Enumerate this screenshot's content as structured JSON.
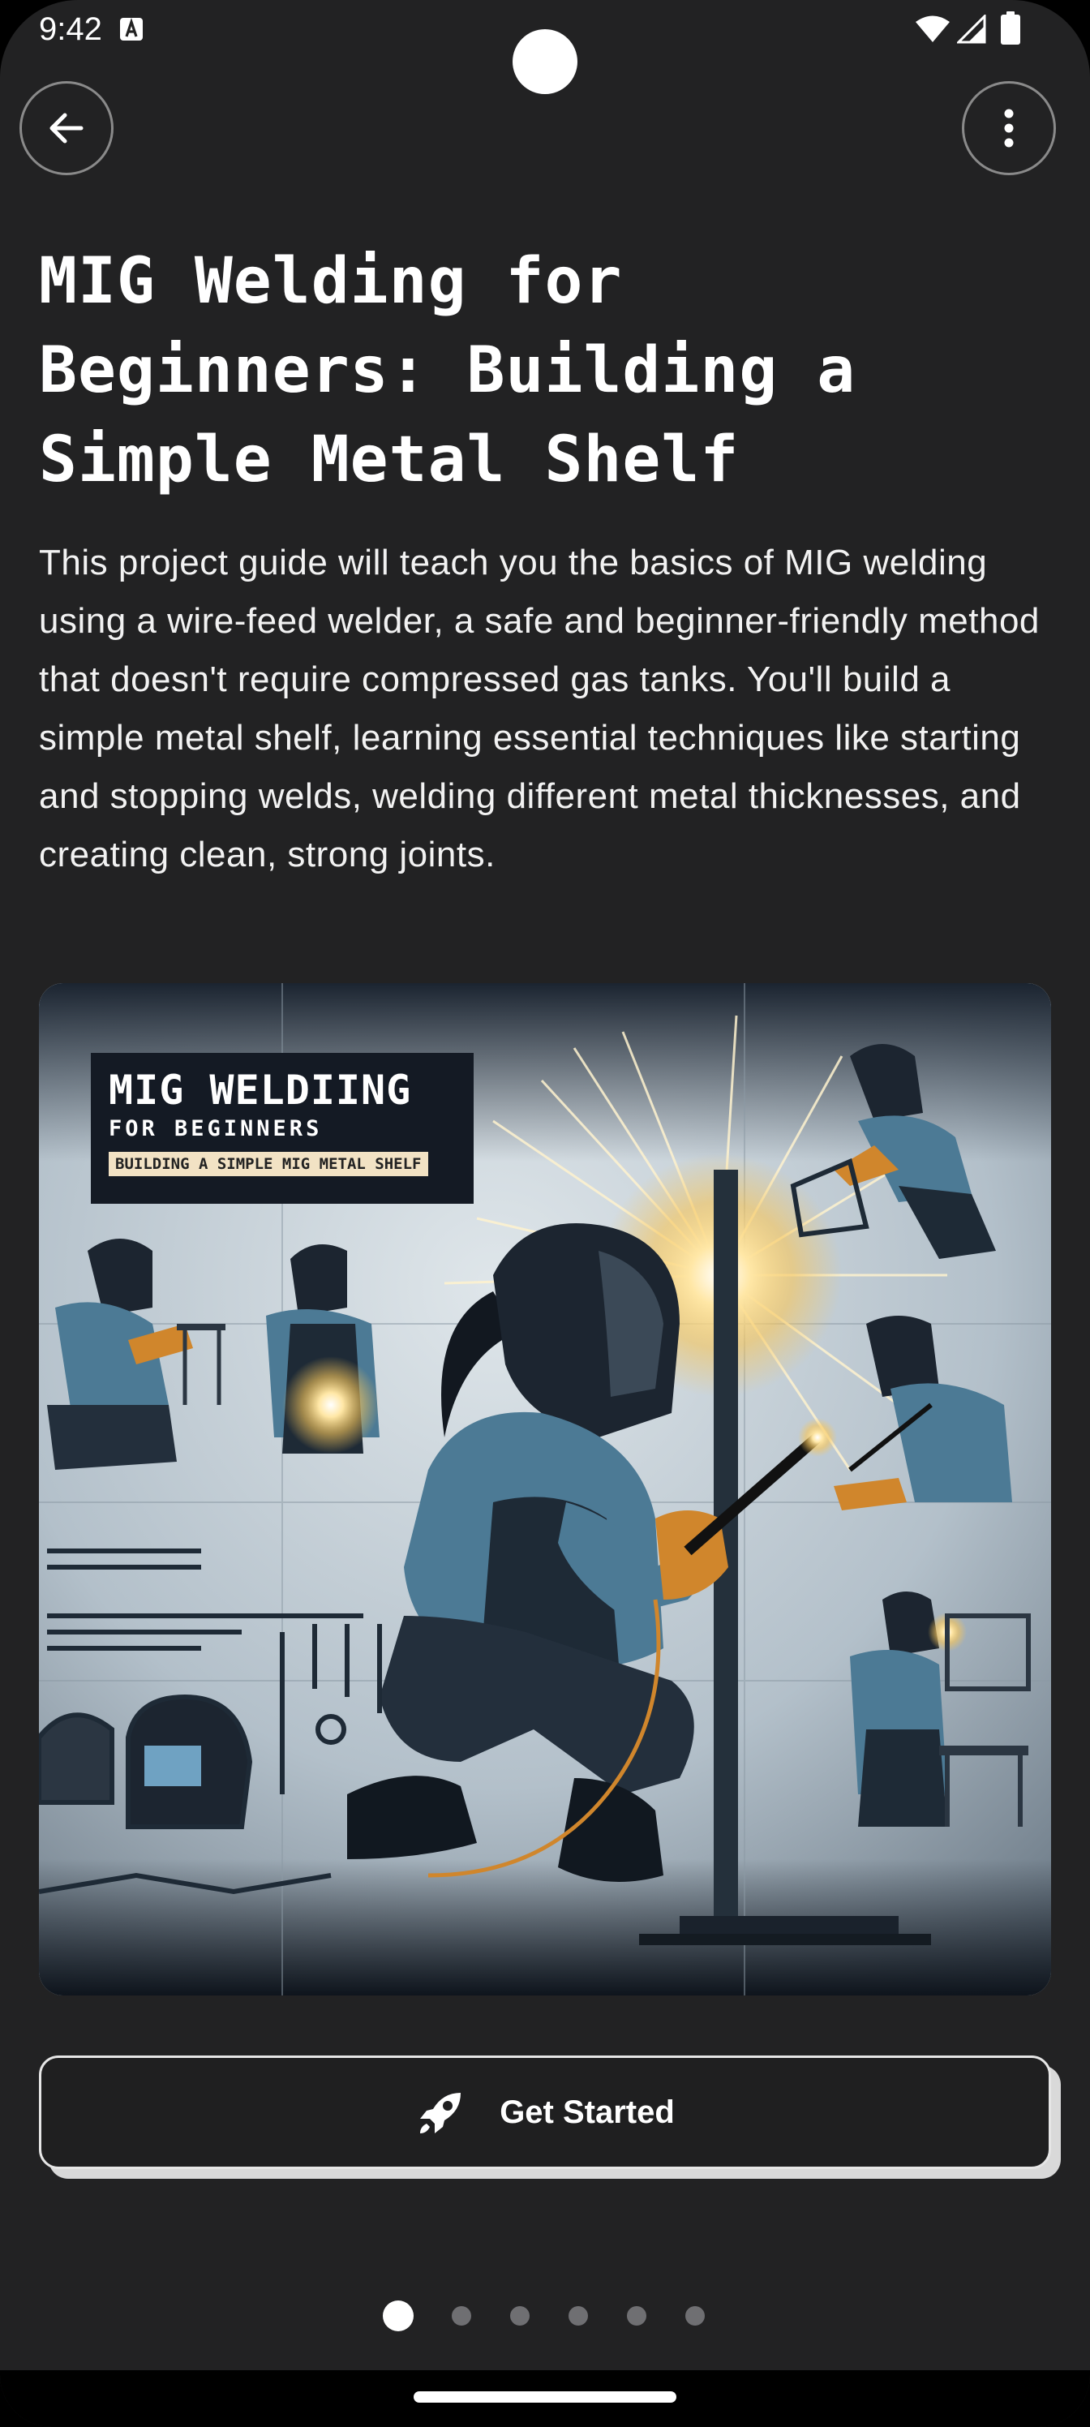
{
  "status_bar": {
    "time": "9:42",
    "icons": [
      "notification-a-icon",
      "wifi-icon",
      "signal-icon",
      "battery-icon"
    ]
  },
  "app_bar": {
    "back_icon": "arrow-back-icon",
    "more_icon": "more-vert-icon"
  },
  "project": {
    "title": "MIG Welding for Beginners: Building a Simple Metal Shelf",
    "description": "This project guide will teach you the basics of MIG welding using a wire-feed welder, a safe and beginner-friendly method that doesn't require compressed gas tanks. You'll build a simple metal shelf, learning essential techniques like starting and stopping welds, welding different metal thicknesses, and creating clean, strong joints."
  },
  "hero_image": {
    "label_title": "MIG WELDIING",
    "label_subtitle": "FOR BEGINNERS",
    "label_tag": "BUILDING A  SIMPLE  MIG METAL SHELF"
  },
  "cta": {
    "label": "Get Started",
    "icon": "rocket-icon"
  },
  "pager": {
    "total": 6,
    "active_index": 0
  },
  "colors": {
    "background": "#222223",
    "text": "#ffffff",
    "button_border": "#e6e6e6",
    "button_shadow": "#d9d9d9",
    "dot_inactive": "#6f6f72",
    "spark": "#f7c65a"
  }
}
